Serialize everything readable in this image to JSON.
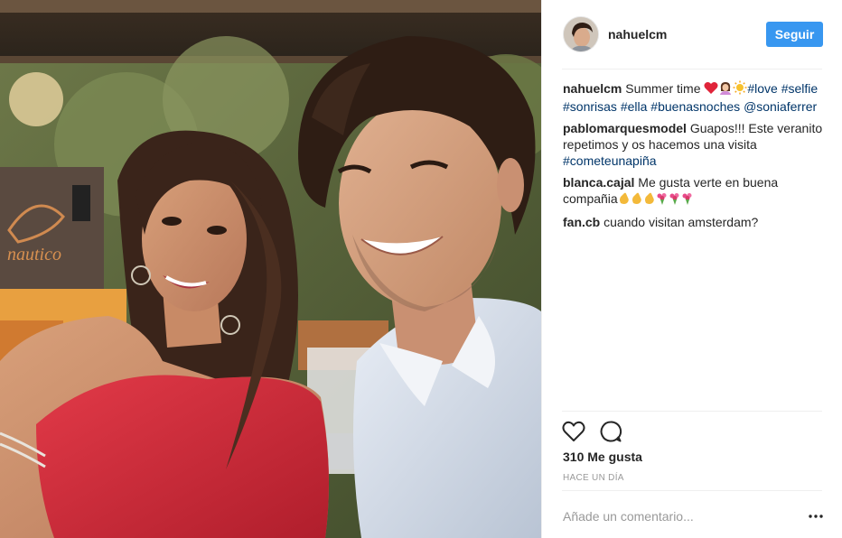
{
  "post": {
    "photo_icon": "selfie-photo",
    "header": {
      "username": "nahuelcm",
      "follow_label": "Seguir",
      "avatar_icon": "profile-avatar"
    },
    "comments": [
      {
        "user": "nahuelcm",
        "text": "Summer time",
        "emojis": [
          "heart-emoji",
          "woman-emoji",
          "sun-emoji"
        ],
        "tags": [
          "#love",
          "#selfie",
          "#sonrisas",
          "#ella",
          "#buenasnoches",
          "@soniaferrer"
        ]
      },
      {
        "user": "pablomarquesmodel",
        "text": "Guapos!!! Este veranito repetimos y os hacemos una visita",
        "tags": [
          "#cometeunapiña"
        ]
      },
      {
        "user": "blanca.cajal",
        "text": "Me gusta verte en buena compañia",
        "emojis": [
          "clap-emoji",
          "clap-emoji",
          "clap-emoji",
          "bouquet-emoji",
          "bouquet-emoji",
          "bouquet-emoji"
        ]
      },
      {
        "user": "fan.cb",
        "text": "cuando visitan amsterdam?"
      }
    ],
    "actions": {
      "like_icon": "heart-icon",
      "comment_icon": "comment-bubble-icon"
    },
    "likes_text": "310 Me gusta",
    "time_text": "HACE UN DÍA",
    "add_comment": {
      "placeholder": "Añade un comentario...",
      "more_icon": "ellipsis-icon"
    },
    "colors": {
      "accent": "#3897f0",
      "hashtag": "#003569",
      "muted": "#999999",
      "divider": "#efefef"
    }
  }
}
